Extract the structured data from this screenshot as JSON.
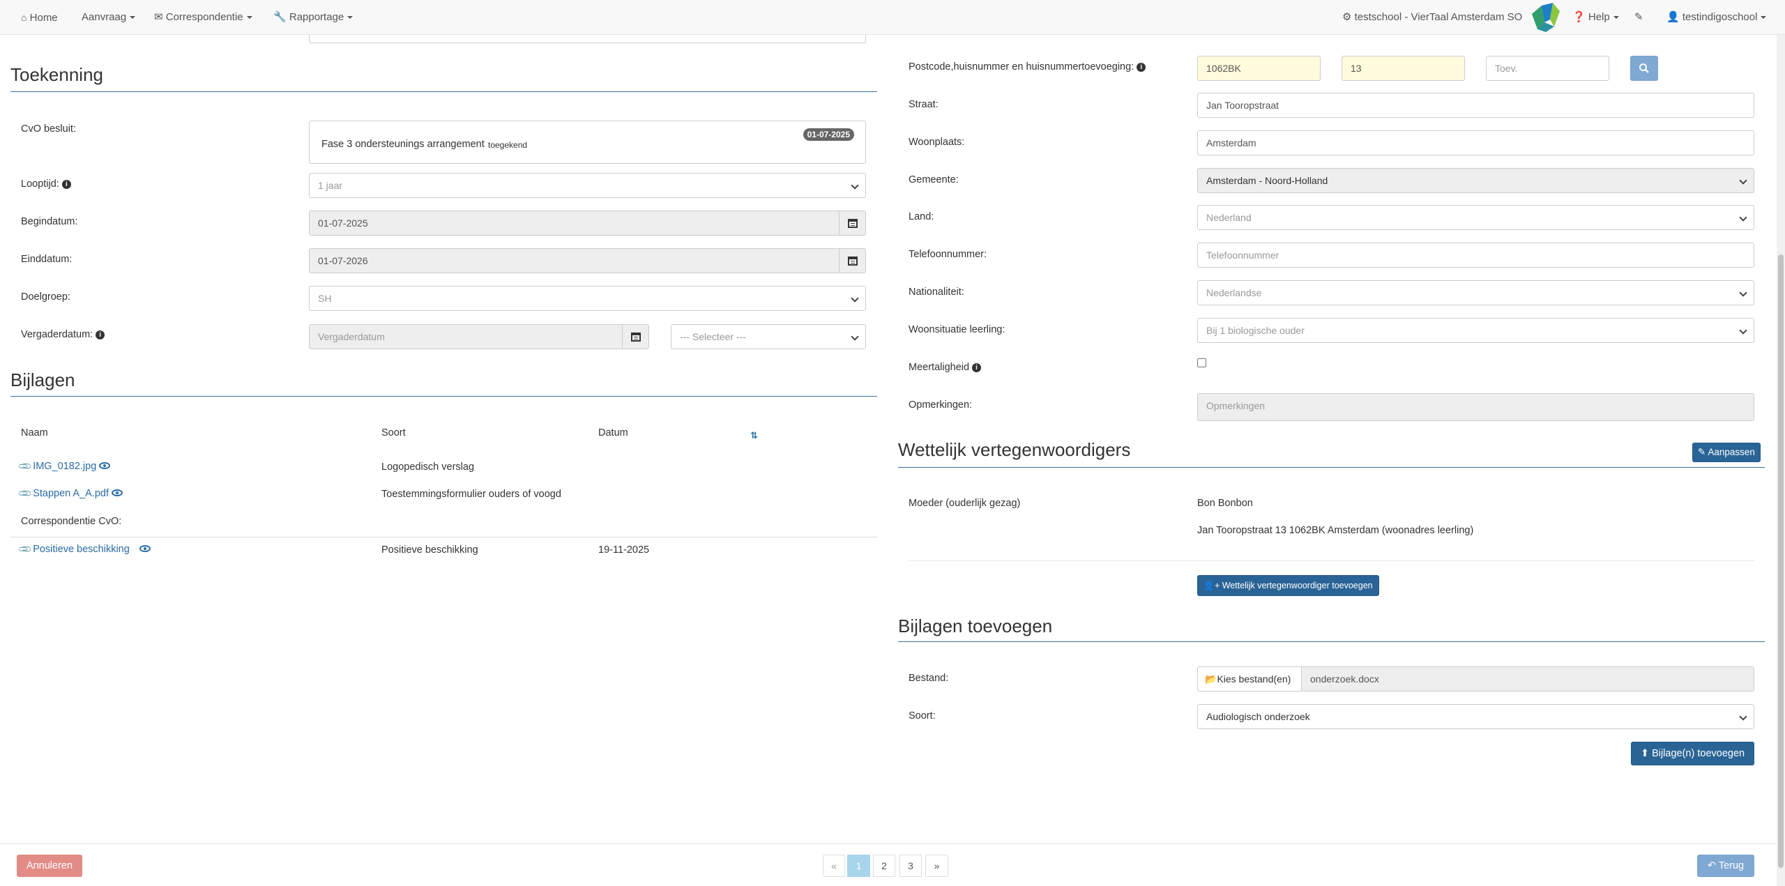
{
  "navbar": {
    "home": "Home",
    "aanvraag": "Aanvraag",
    "correspondentie": "Correspondentie",
    "rapportage": "Rapportage",
    "school": "testschool - VierTaal Amsterdam SO",
    "help": "Help",
    "user": "testindigoschool"
  },
  "toekenning": {
    "title": "Toekenning",
    "cvo_label": "CvO besluit:",
    "cvo_text": "Fase 3 ondersteunings arrangement",
    "cvo_status": "toegekend",
    "cvo_badge": "01-07-2025",
    "looptijd_label": "Looptijd:",
    "looptijd_value": "1 jaar",
    "begindatum_label": "Begindatum:",
    "begindatum_value": "01-07-2025",
    "einddatum_label": "Einddatum:",
    "einddatum_value": "01-07-2026",
    "doelgroep_label": "Doelgroep:",
    "doelgroep_value": "SH",
    "vergaderdatum_label": "Vergaderdatum:",
    "vergaderdatum_placeholder": "Vergaderdatum",
    "selecteer_value": "--- Selecteer ---"
  },
  "bijlagen": {
    "title": "Bijlagen",
    "headers": [
      "Naam",
      "Soort",
      "Datum"
    ],
    "rows": [
      {
        "naam": "IMG_0182.jpg",
        "soort": "Logopedisch verslag",
        "datum": ""
      },
      {
        "naam": "Stappen A_A.pdf",
        "soort": "Toestemmingsformulier ouders of voogd",
        "datum": ""
      }
    ],
    "correspondentie_label": "Correspondentie CvO:",
    "corr_row": {
      "naam": "Positieve beschikking",
      "soort": "Positieve beschikking",
      "datum": "19-11-2025"
    }
  },
  "adres": {
    "postcode_label": "Postcode,huisnummer en huisnummertoevoeging:",
    "postcode_value": "1062BK",
    "huisnummer_value": "13",
    "toev_placeholder": "Toev.",
    "straat_label": "Straat:",
    "straat_value": "Jan Tooropstraat",
    "woonplaats_label": "Woonplaats:",
    "woonplaats_value": "Amsterdam",
    "gemeente_label": "Gemeente:",
    "gemeente_value": "Amsterdam - Noord-Holland",
    "land_label": "Land:",
    "land_value": "Nederland",
    "telefoon_label": "Telefoonnummer:",
    "telefoon_placeholder": "Telefoonnummer",
    "nationaliteit_label": "Nationaliteit:",
    "nationaliteit_value": "Nederlandse",
    "woonsituatie_label": "Woonsituatie leerling:",
    "woonsituatie_value": "Bij 1 biologische ouder",
    "meertaligheid_label": "Meertaligheid",
    "opmerkingen_label": "Opmerkingen:",
    "opmerkingen_placeholder": "Opmerkingen"
  },
  "vertegenwoordigers": {
    "title": "Wettelijk vertegenwoordigers",
    "aanpassen": "Aanpassen",
    "rol": "Moeder (ouderlijk gezag)",
    "naam": "Bon Bonbon",
    "adres": "Jan Tooropstraat 13 1062BK Amsterdam (woonadres leerling)",
    "toevoegen": "Wettelijk vertegenwoordiger toevoegen"
  },
  "bijlagen_toevoegen": {
    "title": "Bijlagen toevoegen",
    "bestand_label": "Bestand:",
    "kies": "Kies bestand(en)",
    "bestand_value": "onderzoek.docx",
    "soort_label": "Soort:",
    "soort_value": "Audiologisch onderzoek",
    "submit": "Bijlage(n) toevoegen"
  },
  "footer": {
    "annuleren": "Annuleren",
    "prev": "«",
    "pages": [
      "1",
      "2",
      "3"
    ],
    "next": "»",
    "terug": "Terug"
  },
  "colors": {
    "primary": "#2a6496",
    "active_page": "#a8d4ec",
    "danger": "#e38b87"
  }
}
